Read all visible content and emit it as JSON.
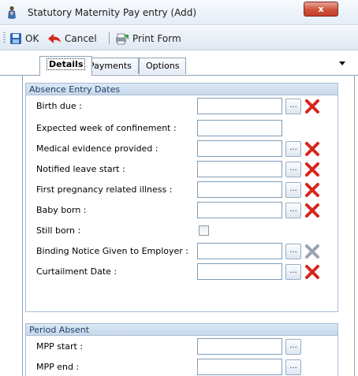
{
  "window": {
    "title": "Statutory Maternity Pay entry (Add)",
    "close_label": "x"
  },
  "toolbar": {
    "ok_label": "OK",
    "cancel_label": "Cancel",
    "print_label": "Print Form"
  },
  "tabs": [
    {
      "label": "Details"
    },
    {
      "label": "Payments"
    },
    {
      "label": "Options"
    }
  ],
  "absence": {
    "header": "Absence Entry Dates",
    "fields": [
      {
        "label": "Birth due :",
        "value": ""
      },
      {
        "label": "Expected week of confinement :",
        "value": ""
      },
      {
        "label": "Medical evidence provided :",
        "value": ""
      },
      {
        "label": "Notified leave start :",
        "value": ""
      },
      {
        "label": "First pregnancy related illness :",
        "value": ""
      },
      {
        "label": "Baby born :",
        "value": ""
      },
      {
        "label": "Still born :",
        "checked": false
      },
      {
        "label": "Binding Notice Given to Employer :",
        "value": "",
        "clear_enabled": false
      },
      {
        "label": "Curtailment Date :",
        "value": ""
      }
    ]
  },
  "period": {
    "header": "Period Absent",
    "fields": [
      {
        "label": "MPP start :",
        "value": ""
      },
      {
        "label": "MPP end :",
        "value": ""
      }
    ]
  },
  "buttons": {
    "ellipsis_label": "..."
  },
  "colors": {
    "clear_red": "#d8261b",
    "clear_disabled": "#9aa3ad",
    "group_header": "#c7d8eb"
  }
}
